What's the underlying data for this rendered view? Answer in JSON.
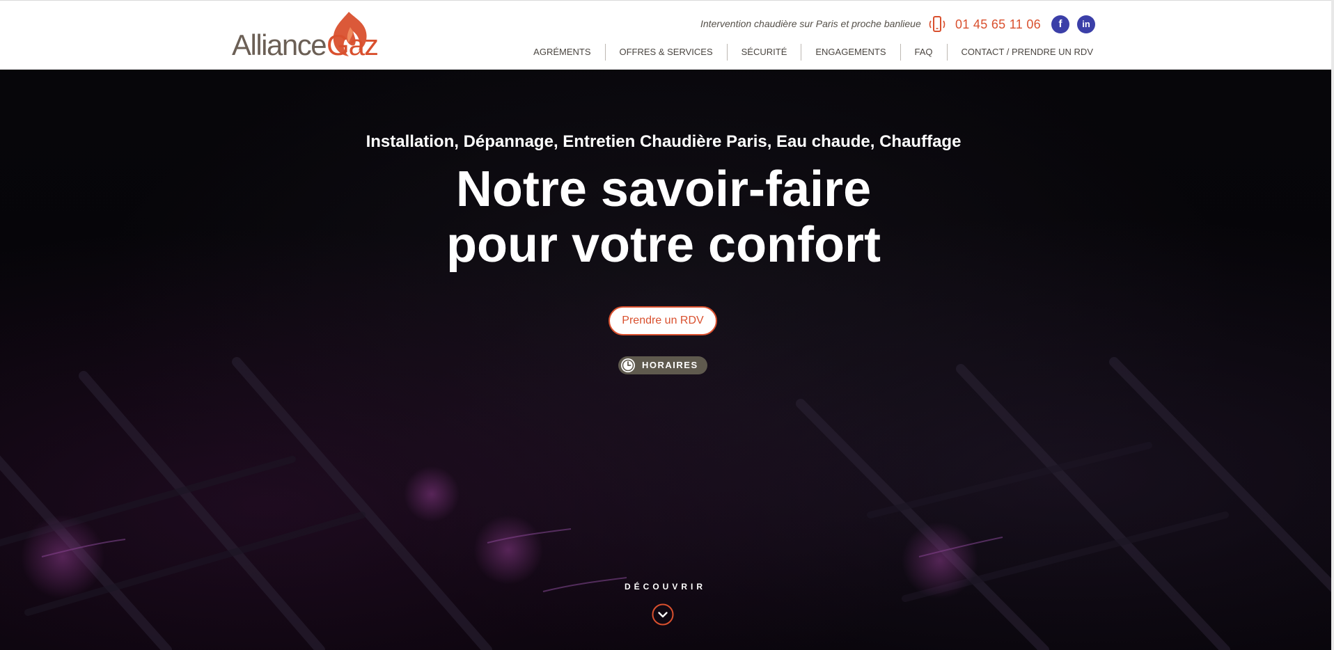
{
  "brand": {
    "name_part1": "Alliance",
    "name_part2": "Gaz",
    "accent_color": "#d9502e",
    "text_color": "#6b5f55"
  },
  "header": {
    "tagline": "Intervention chaudière sur Paris et proche banlieue",
    "phone": "01 45 65 11 06",
    "phone_icon": "smartphone-vibrate-icon",
    "social": [
      {
        "name": "facebook-icon",
        "label": "f"
      },
      {
        "name": "linkedin-icon",
        "label": "in"
      }
    ],
    "nav": [
      {
        "label": "AGRÉMENTS"
      },
      {
        "label": "OFFRES & SERVICES"
      },
      {
        "label": "SÉCURITÉ"
      },
      {
        "label": "ENGAGEMENTS"
      },
      {
        "label": "FAQ"
      },
      {
        "label": "CONTACT / PRENDRE UN RDV"
      }
    ]
  },
  "hero": {
    "subtitle": "Installation, Dépannage, Entretien Chaudière Paris, Eau chaude, Chauffage",
    "headline_line1": "Notre savoir-faire",
    "headline_line2": "pour votre confort",
    "cta_label": "Prendre un RDV",
    "hours_label": "HORAIRES",
    "hours_icon": "clock-icon",
    "discover_label": "DÉCOUVRIR",
    "discover_icon": "chevron-down-circle-icon"
  }
}
